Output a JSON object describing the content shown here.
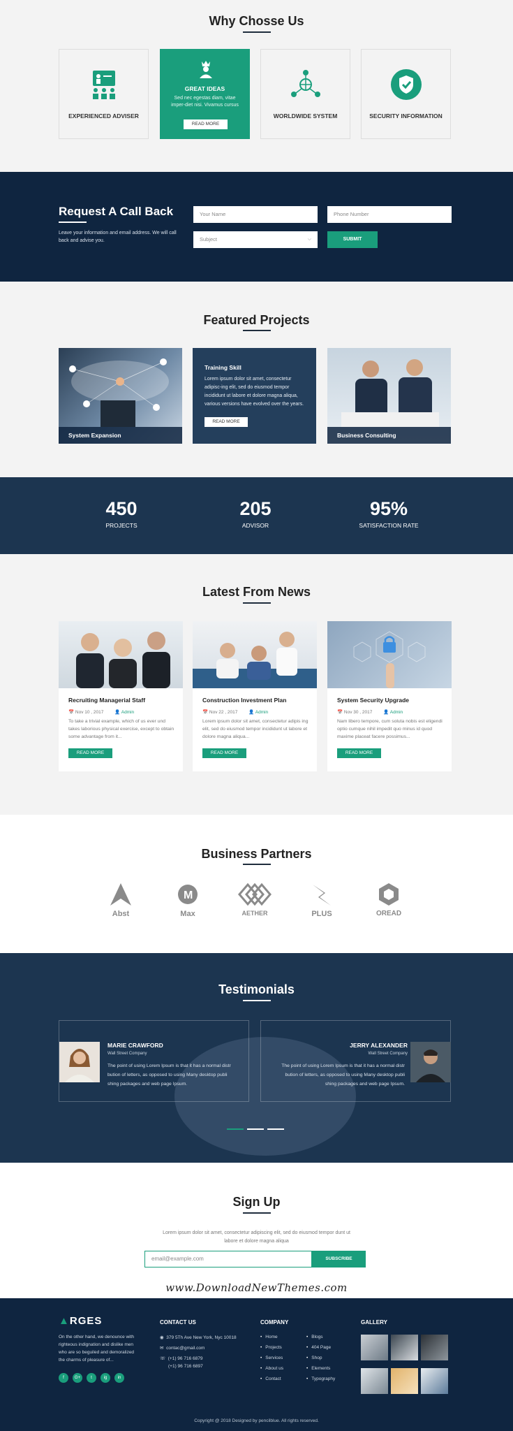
{
  "why": {
    "title": "Why Chosse Us",
    "cards": [
      {
        "label": "EXPERIENCED ADVISER",
        "icon": "presentation-icon"
      },
      {
        "label": "GREAT IDEAS",
        "icon": "crown-person-icon",
        "desc": "Sed nec egestas diam, vitae imper-diet nisi. Vivamus cursus",
        "button": "READ MORE"
      },
      {
        "label": "WORLDWIDE SYSTEM",
        "icon": "network-icon"
      },
      {
        "label": "SECURITY INFORMATION",
        "icon": "shield-check-icon"
      }
    ]
  },
  "callback": {
    "title": "Request A Call Back",
    "text": "Leave your information and email address. We will call back and advise you.",
    "name_placeholder": "Your Name",
    "phone_placeholder": "Phone Number",
    "subject_placeholder": "Subject",
    "submit": "SUBMIT"
  },
  "featured": {
    "title": "Featured Projects",
    "projects": [
      {
        "caption": "System Expansion"
      },
      {
        "title": "Training Skill",
        "desc": "Lorem ipsum dolor sit amet, consectetur adipisc-ing elit, sed do eiusmod tempor incididunt ut labore et dolore magna aliqua, various versions have evolved over the years.",
        "button": "READ MORE"
      },
      {
        "caption": "Business Consulting"
      }
    ]
  },
  "stats": [
    {
      "value": "450",
      "label": "PROJECTS"
    },
    {
      "value": "205",
      "label": "ADVISOR"
    },
    {
      "value": "95%",
      "label": "SATISFACTION RATE"
    }
  ],
  "news": {
    "title": "Latest From News",
    "items": [
      {
        "title": "Recruiting Managerial Staff",
        "date": "Nov 10 , 2017",
        "author": "Admin",
        "desc": "To take a trivial example, which of us ever und takes laborious physical exercise, except to obtain some advantage from it...",
        "button": "READ MORE"
      },
      {
        "title": "Construction Investment Plan",
        "date": "Nov 22 , 2017",
        "author": "Admin",
        "desc": "Lorem ipsum dolor sit amet, consectetur adipis ing elit, sed do eiusmod tempor incididunt ut labore et dolore magna aliqua...",
        "button": "READ MORE"
      },
      {
        "title": "System Security Upgrade",
        "date": "Nov 30 , 2017",
        "author": "Admin",
        "desc": "Nam libero tempore, cum soluta nobis est eligendi optio cumque nihil impedit quo minus id quod maxime placeat facere possimus...",
        "button": "READ MORE"
      }
    ]
  },
  "partners": {
    "title": "Business Partners",
    "logos": [
      "Abst",
      "Max",
      "AETHER",
      "PLUS",
      "OREAD"
    ]
  },
  "testimonials": {
    "title": "Testimonials",
    "items": [
      {
        "name": "MARIE CRAWFORD",
        "company": "Wall Street Company",
        "quote": "The point of using Lorem Ipsum is that it has a normal distr bution of letters, as opposed to using Many desktop publi shing packages and web page Ipsum."
      },
      {
        "name": "JERRY ALEXANDER",
        "company": "Wall Street Company",
        "quote": "The point of using Lorem Ipsum is that it has a normal distr bution of letters, as opposed to using Many desktop publi shing packages and web page Ipsum."
      }
    ]
  },
  "signup": {
    "title": "Sign Up",
    "text": "Lorem ipsum dolor sit amet, consectetur adipiscing elit, sed do eiusmod tempor dunt ut labore et dolore magna aliqua",
    "email_placeholder": "email@example.com",
    "button": "SUBSCRIBE",
    "watermark": "www.DownloadNewThemes.com"
  },
  "footer": {
    "logo": "RGES",
    "about": "On the other hand, we denounce with righteous indignation and dislike men who are so beguiled and demoralized the charms of pleasure of...",
    "social": [
      "f",
      "G+",
      "t",
      "ig",
      "in"
    ],
    "contact_title": "CONTACT US",
    "address": "379 5Th Ave New York, Nyc 10018",
    "email": "contac@gmail.com",
    "phone1": "(+1) 96 716 6879",
    "phone2": "(+1) 96 716 6897",
    "company_title": "COMPANY",
    "company_links_1": [
      "Home",
      "Projects",
      "Services",
      "About us",
      "Contact"
    ],
    "company_links_2": [
      "Blogs",
      "404 Page",
      "Shop",
      "Elements",
      "Typography"
    ],
    "gallery_title": "GALLERY",
    "copyright": "Copyright @ 2018 Designed by pencilblue. All rights reserved."
  },
  "colors": {
    "accent": "#1a9e7c",
    "navy": "#0f2540",
    "light": "#f3f3f3"
  }
}
